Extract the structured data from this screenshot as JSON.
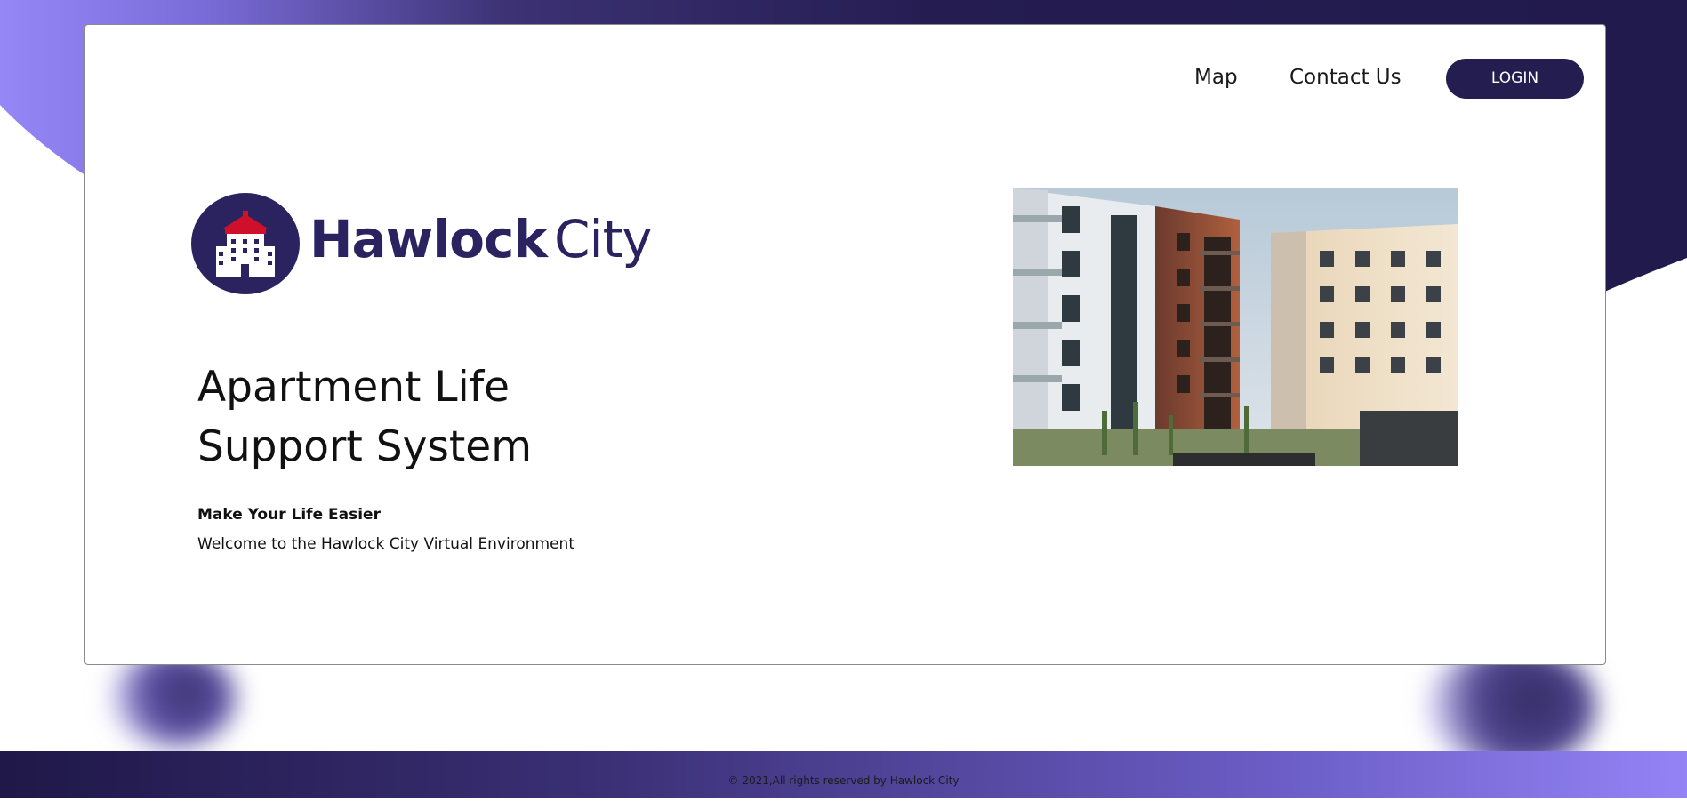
{
  "nav": {
    "map_label": "Map",
    "contact_label": "Contact Us",
    "login_label": "LOGIN"
  },
  "brand": {
    "name_strong": "Hawlock",
    "name_light": "City",
    "logo_icon": "apartment-building-icon"
  },
  "hero": {
    "headline_line1": "Apartment Life",
    "headline_line2": "Support System",
    "tagline": "Make Your Life Easier",
    "welcome": "Welcome to the Hawlock City Virtual Environment"
  },
  "image": {
    "description": "apartment-buildings-photo"
  },
  "footer": {
    "copyright": "© 2021,All rights reserved by Hawlock City"
  },
  "colors": {
    "primary_dark": "#241d4f",
    "brand": "#2a2360",
    "accent_light": "#9383f5",
    "logo_roof": "#d0102a"
  }
}
